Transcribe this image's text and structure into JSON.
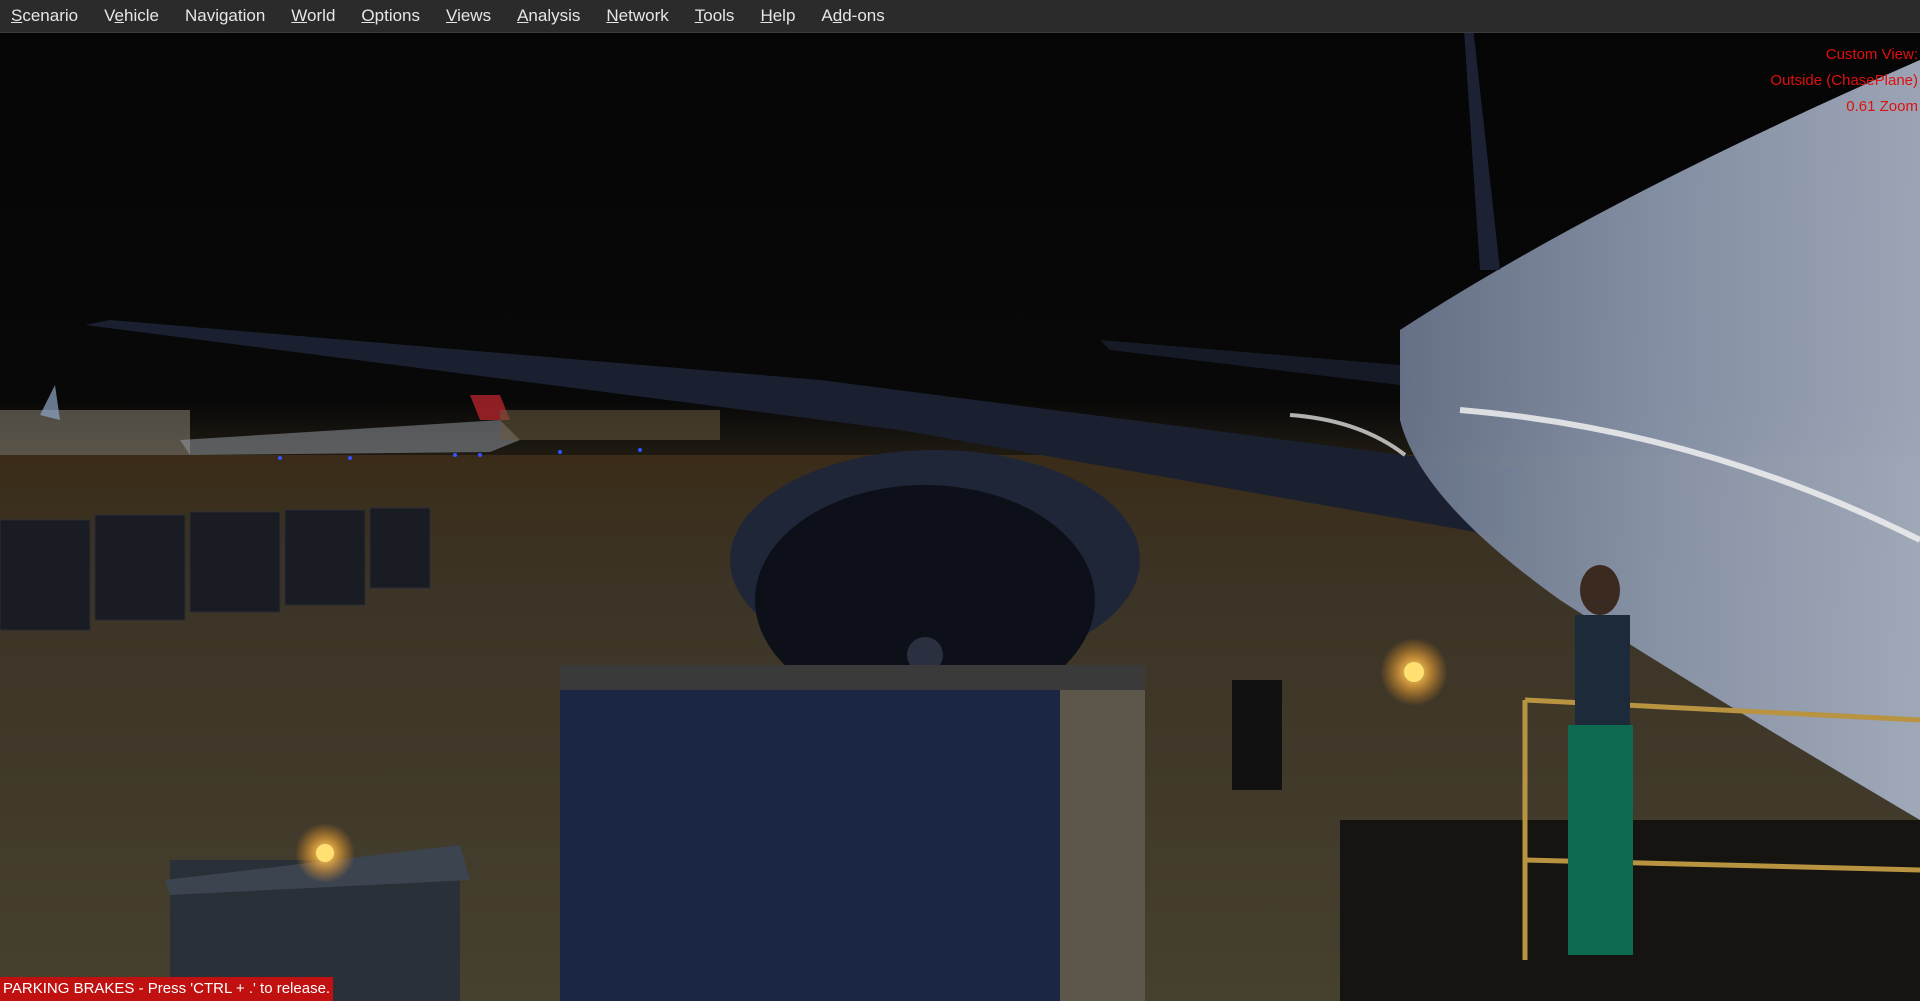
{
  "menu": {
    "items": [
      {
        "label": "Scenario",
        "accel": "S",
        "rest": "cenario"
      },
      {
        "label": "Vehicle",
        "accel_pre": "V",
        "accel": "e",
        "rest": "hicle"
      },
      {
        "label": "Navigation",
        "accel_pre": "",
        "accel": "N",
        "rest": "avigation"
      },
      {
        "label": "World",
        "accel": "W",
        "rest": "orld"
      },
      {
        "label": "Options",
        "accel": "O",
        "rest": "ptions"
      },
      {
        "label": "Views",
        "accel": "V",
        "rest": "iews"
      },
      {
        "label": "Analysis",
        "accel": "A",
        "rest": "nalysis"
      },
      {
        "label": "Network",
        "accel": "N",
        "rest": "etwork"
      },
      {
        "label": "Tools",
        "accel": "T",
        "rest": "ools"
      },
      {
        "label": "Help",
        "accel": "H",
        "rest": "elp"
      },
      {
        "label": "Add-ons",
        "accel_pre": "A",
        "accel": "d",
        "rest": "d-ons"
      }
    ]
  },
  "view_info": {
    "line1": "Custom View:",
    "line2": "Outside (ChasePlane)",
    "line3": "0.61 Zoom"
  },
  "status": {
    "message": "PARKING BRAKES - Press 'CTRL + .' to release."
  },
  "colors": {
    "menu_bg": "#2b2b2b",
    "menu_text": "#e6e6e6",
    "overlay_text": "#e01010",
    "status_bg": "#c01010",
    "status_text": "#ffffff"
  }
}
